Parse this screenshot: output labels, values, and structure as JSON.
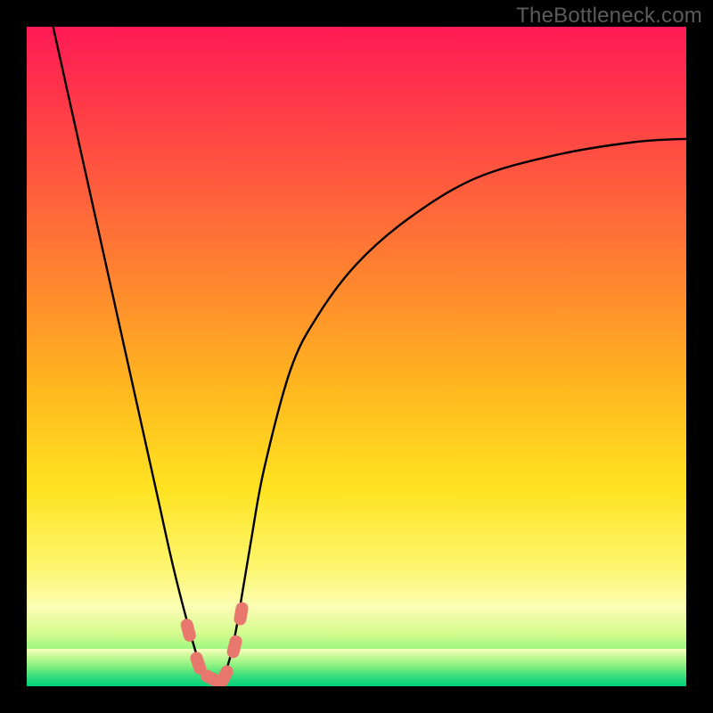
{
  "watermark": "TheBottleneck.com",
  "chart_data": {
    "type": "line",
    "title": "",
    "xlabel": "",
    "ylabel": "",
    "xlim": [
      0,
      100
    ],
    "ylim": [
      0,
      100
    ],
    "series": [
      {
        "name": "bottleneck-curve",
        "x": [
          4,
          6,
          8,
          10,
          12,
          14,
          16,
          18,
          20,
          22,
          24,
          26,
          27,
          28,
          29,
          30,
          31,
          32,
          34,
          36,
          40,
          44,
          50,
          58,
          68,
          80,
          92,
          100
        ],
        "y": [
          100,
          91,
          82,
          73,
          64,
          55,
          46,
          37,
          28,
          19,
          11,
          4,
          2,
          1,
          1,
          2,
          5,
          10,
          22,
          33,
          48,
          56,
          64,
          71,
          77,
          80.5,
          82.5,
          83
        ]
      }
    ],
    "markers": [
      {
        "name": "marker-a",
        "x": 24.5,
        "y": 8.5
      },
      {
        "name": "marker-b",
        "x": 26.0,
        "y": 3.5
      },
      {
        "name": "marker-c",
        "x": 28.0,
        "y": 1.2
      },
      {
        "name": "marker-d",
        "x": 30.0,
        "y": 1.5
      },
      {
        "name": "marker-e",
        "x": 31.5,
        "y": 6.0
      },
      {
        "name": "marker-f",
        "x": 32.5,
        "y": 11.0
      }
    ],
    "marker_color": "#e8776d",
    "curve_color": "#000000"
  }
}
